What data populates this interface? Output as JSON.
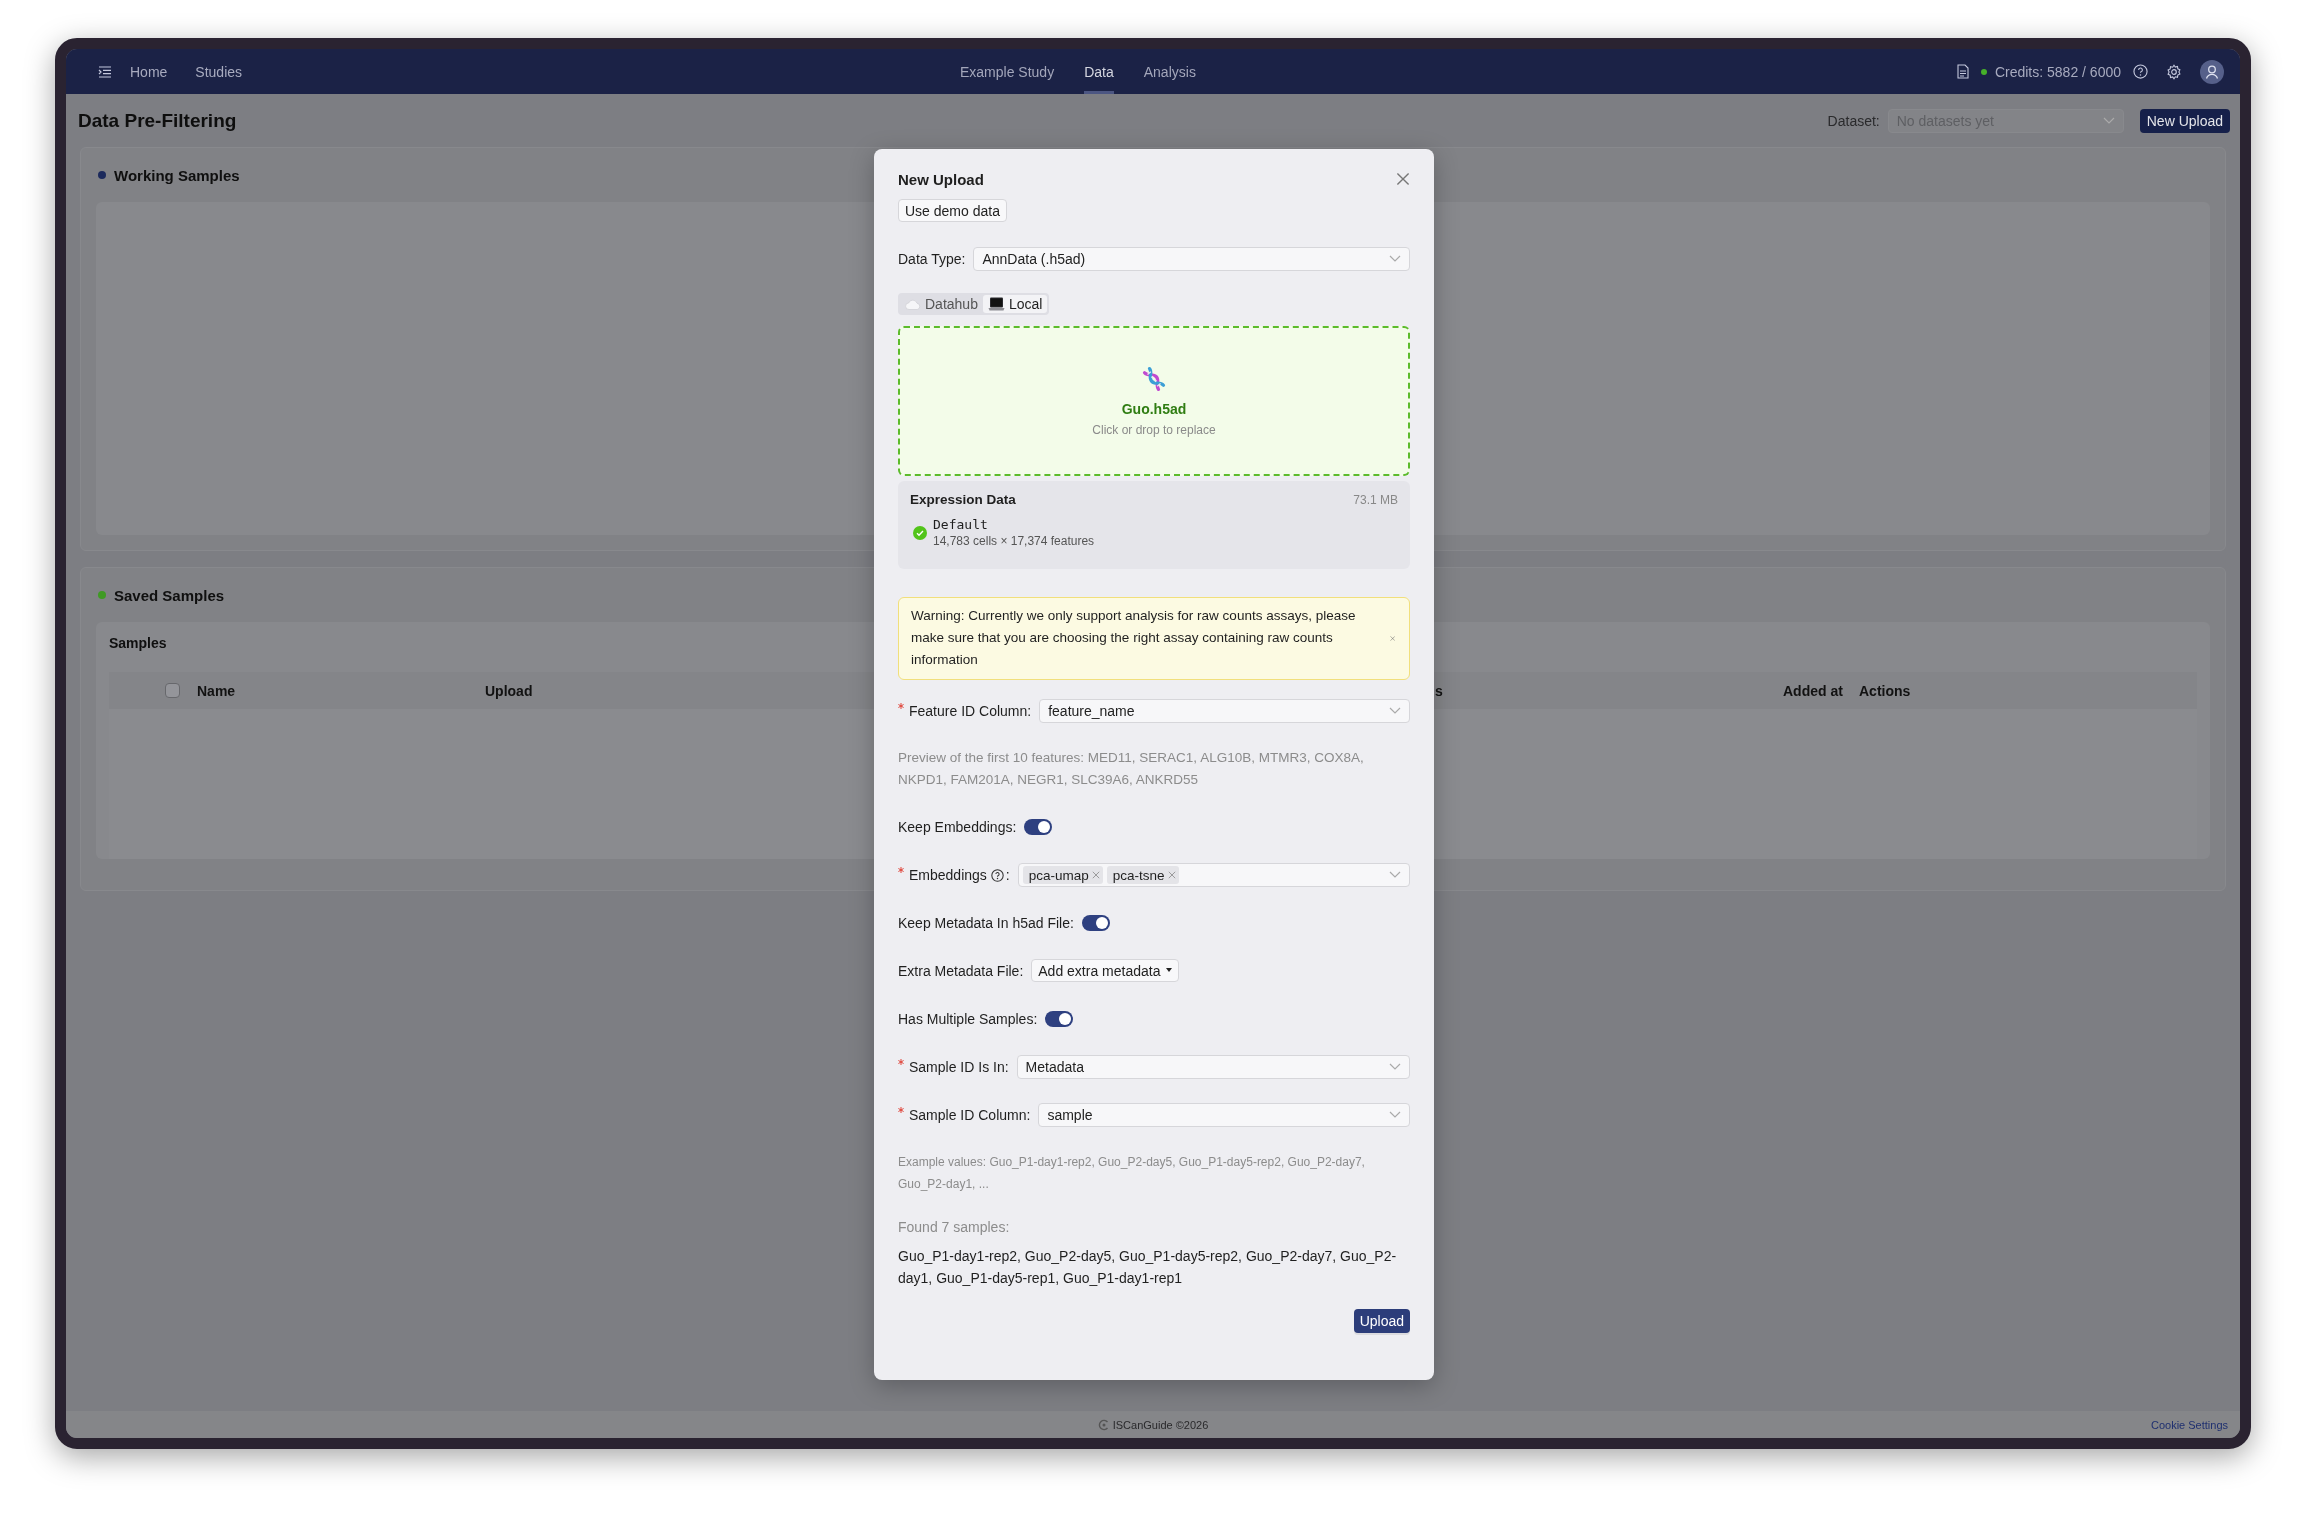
{
  "nav": {
    "links": [
      {
        "label": "Home"
      },
      {
        "label": "Studies"
      }
    ],
    "tabs": [
      {
        "label": "Example Study",
        "selected": false
      },
      {
        "label": "Data",
        "selected": true
      },
      {
        "label": "Analysis",
        "selected": false
      }
    ],
    "credits": "Credits: 5882 / 6000"
  },
  "page": {
    "title": "Data Pre-Filtering",
    "dataset_label": "Dataset:",
    "dataset_placeholder": "No datasets yet",
    "new_upload": "New Upload"
  },
  "sections": [
    {
      "title": "Working Samples",
      "color": "#1c2a5c"
    },
    {
      "title": "Saved Samples",
      "color": "#3f9a24",
      "table": {
        "title": "Samples",
        "select_all_checked": false,
        "columns": [
          "Name",
          "Upload",
          "s",
          "Added at",
          "Actions"
        ]
      }
    }
  ],
  "modal": {
    "title": "New Upload",
    "demo_button": "Use demo data",
    "data_type": {
      "label": "Data Type:",
      "value": "AnnData (.h5ad)"
    },
    "sources": [
      {
        "label": "Datahub",
        "kind": "cloud",
        "selected": false
      },
      {
        "label": "Local",
        "kind": "laptop",
        "selected": true
      }
    ],
    "dropzone": {
      "file": "Guo.h5ad",
      "hint": "Click or drop to replace"
    },
    "expression": {
      "title": "Expression Data",
      "size": "73.1 MB",
      "assays": [
        {
          "name": "Default",
          "detail": "14,783 cells × 17,374 features"
        }
      ]
    },
    "warning": "Warning: Currently we only support analysis for raw counts assays, please make sure that you are choosing the right assay containing raw counts information",
    "fields": [
      {
        "kind": "select",
        "label": "Feature ID Column:",
        "required": true,
        "value": "feature_name"
      },
      {
        "kind": "note",
        "text": "Preview of the first 10 features: MED11, SERAC1, ALG10B, MTMR3, COX8A, NKPD1, FAM201A, NEGR1, SLC39A6, ANKRD55"
      },
      {
        "kind": "toggle",
        "label": "Keep Embeddings:",
        "on": true
      },
      {
        "kind": "tags",
        "label": "Embeddings",
        "colon": ":",
        "help": true,
        "required": true,
        "tags": [
          "pca-umap",
          "pca-tsne"
        ]
      },
      {
        "kind": "toggle",
        "label": "Keep Metadata In h5ad File:",
        "on": true
      },
      {
        "kind": "dropdown",
        "label": "Extra Metadata File:",
        "value": "Add extra metadata"
      },
      {
        "kind": "toggle",
        "label": "Has Multiple Samples:",
        "on": true
      },
      {
        "kind": "select",
        "label": "Sample ID Is In:",
        "required": true,
        "value": "Metadata"
      },
      {
        "kind": "select",
        "label": "Sample ID Column:",
        "required": true,
        "value": "sample"
      },
      {
        "kind": "small_note",
        "text": "Example values: Guo_P1-day1-rep2, Guo_P2-day5, Guo_P1-day5-rep2, Guo_P2-day7, Guo_P2-day1, ..."
      },
      {
        "kind": "found",
        "label": "Found 7 samples:",
        "text": "Guo_P1-day1-rep2, Guo_P2-day5, Guo_P1-day5-rep2, Guo_P2-day7, Guo_P2-day1, Guo_P1-day5-rep1, Guo_P1-day1-rep1"
      }
    ],
    "submit": "Upload"
  },
  "footer": {
    "copyright": "ISCanGuide ©2026",
    "link": "Cookie Settings"
  }
}
